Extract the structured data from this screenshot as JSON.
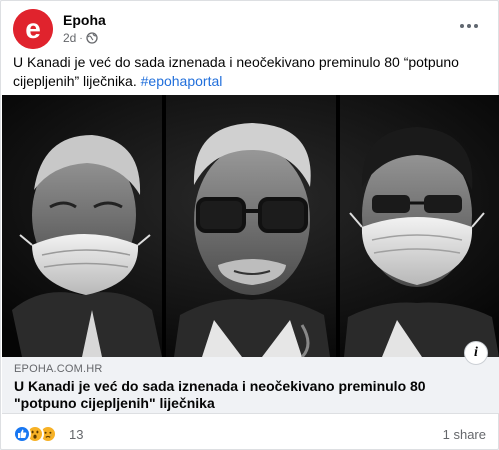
{
  "post": {
    "page_name": "Epoha",
    "time": "2d",
    "text": "U Kanadi je već do sada iznenada i neočekivano preminulo 80 “potpuno cijepljenih” liječnika.",
    "hashtag": "#epohaportal"
  },
  "preview": {
    "domain": "EPOHA.COM.HR",
    "headline": "U Kanadi je već do sada iznenada i neočekivano preminulo 80 \"potpuno cijepljenih\" liječnika"
  },
  "footer": {
    "reaction_icons": [
      "like-icon",
      "wow-icon",
      "sad-icon"
    ],
    "reaction_count": "13",
    "shares": "1 share"
  },
  "colors": {
    "brand_red": "#e0232d",
    "link_blue": "#216fdb",
    "muted": "#65676b"
  }
}
